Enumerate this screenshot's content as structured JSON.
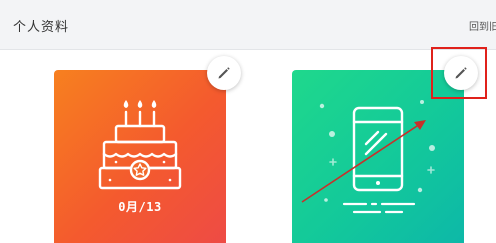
{
  "header": {
    "title": "个人资料",
    "back_link": "回到旧"
  },
  "cards": [
    {
      "type": "birthday",
      "date_label": "0月/13"
    },
    {
      "type": "phone"
    }
  ],
  "colors": {
    "header_bg": "#f3f4f6",
    "birthday_gradient": [
      "#f7801f",
      "#ee4b45"
    ],
    "phone_gradient": [
      "#1fd88c",
      "#0db8a8"
    ],
    "annotation": "#e0211b"
  },
  "icons": [
    "cake-icon",
    "phone-icon",
    "pencil-icon"
  ]
}
